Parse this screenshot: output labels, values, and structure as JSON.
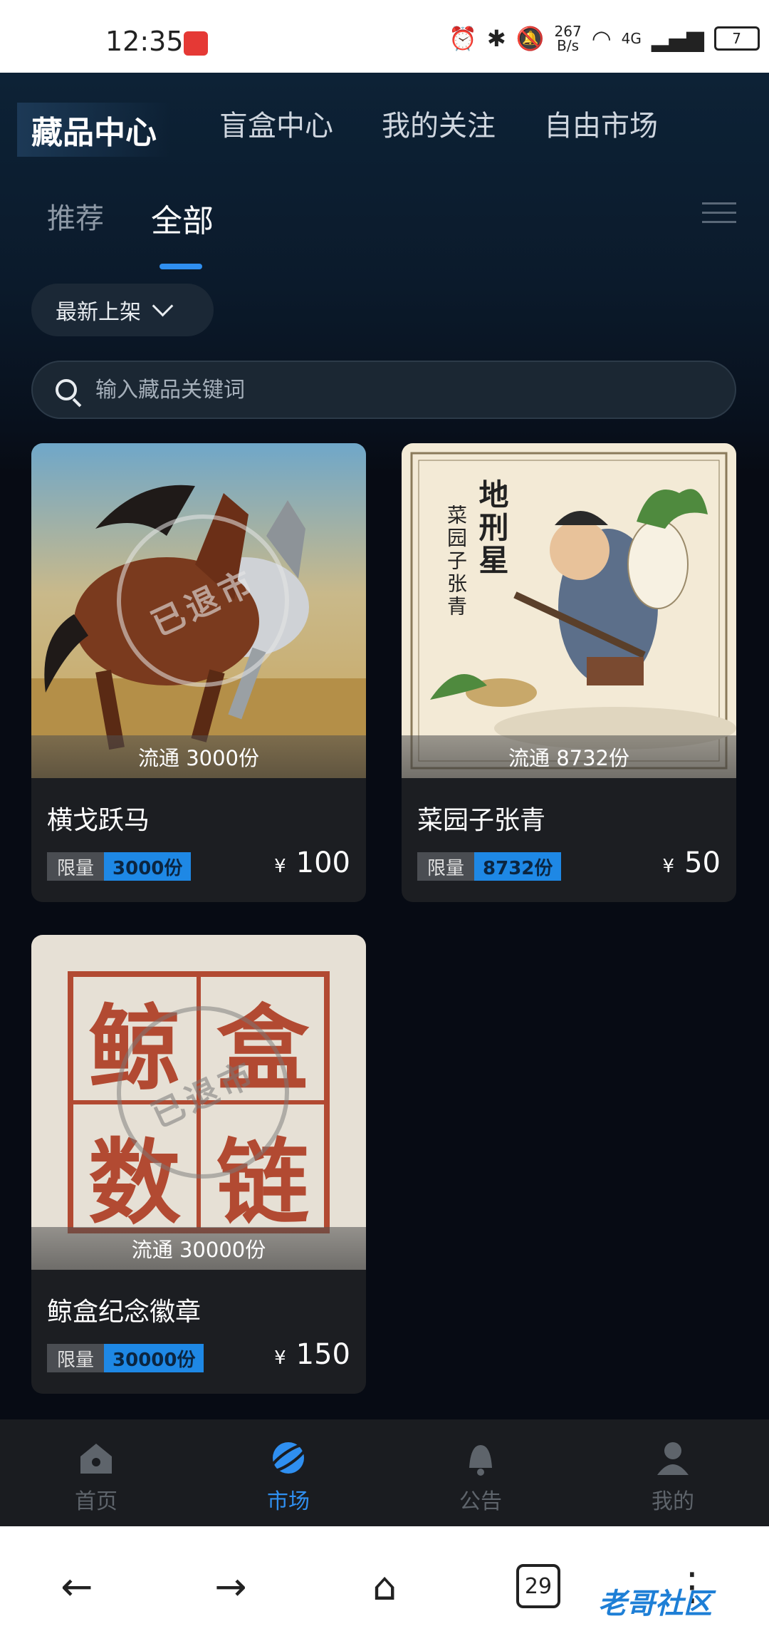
{
  "status": {
    "time": "12:35",
    "speed_value": "267",
    "speed_unit": "B/s",
    "network": "4G",
    "battery": "7"
  },
  "topnav": [
    "藏品中心",
    "盲盒中心",
    "我的关注",
    "自由市场"
  ],
  "subtabs": [
    "推荐",
    "全部"
  ],
  "sort": {
    "label": "最新上架"
  },
  "search": {
    "placeholder": "输入藏品关键词"
  },
  "cards": [
    {
      "name": "横戈跃马",
      "circulation": "流通 3000份",
      "tag_label": "限量",
      "tag_value": "3000份",
      "currency": "¥",
      "price": "100"
    },
    {
      "name": "菜园子张青",
      "circulation": "流通 8732份",
      "tag_label": "限量",
      "tag_value": "8732份",
      "currency": "¥",
      "price": "50"
    },
    {
      "name": "鲸盒纪念徽章",
      "circulation": "流通 30000份",
      "tag_label": "限量",
      "tag_value": "30000份",
      "currency": "¥",
      "price": "150"
    }
  ],
  "stamp_text": "已退市",
  "poster_text": {
    "title": "地刑星",
    "subtitle": "菜园子张青"
  },
  "badge_chars": [
    "鲸",
    "盒",
    "数",
    "链"
  ],
  "bottomnav": [
    "首页",
    "市场",
    "公告",
    "我的"
  ],
  "browser": {
    "tab_count": "29"
  },
  "watermark": "老哥社区"
}
